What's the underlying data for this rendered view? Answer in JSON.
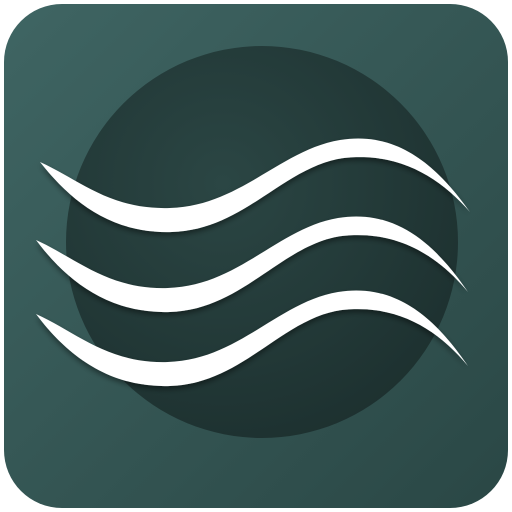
{
  "icon": {
    "name": "wave-app-icon",
    "colors": {
      "tile_light": "#3f6563",
      "tile_dark": "#2a4745",
      "circle_light": "#2b4644",
      "circle_dark": "#1c2f2e",
      "wave": "#ffffff"
    }
  }
}
